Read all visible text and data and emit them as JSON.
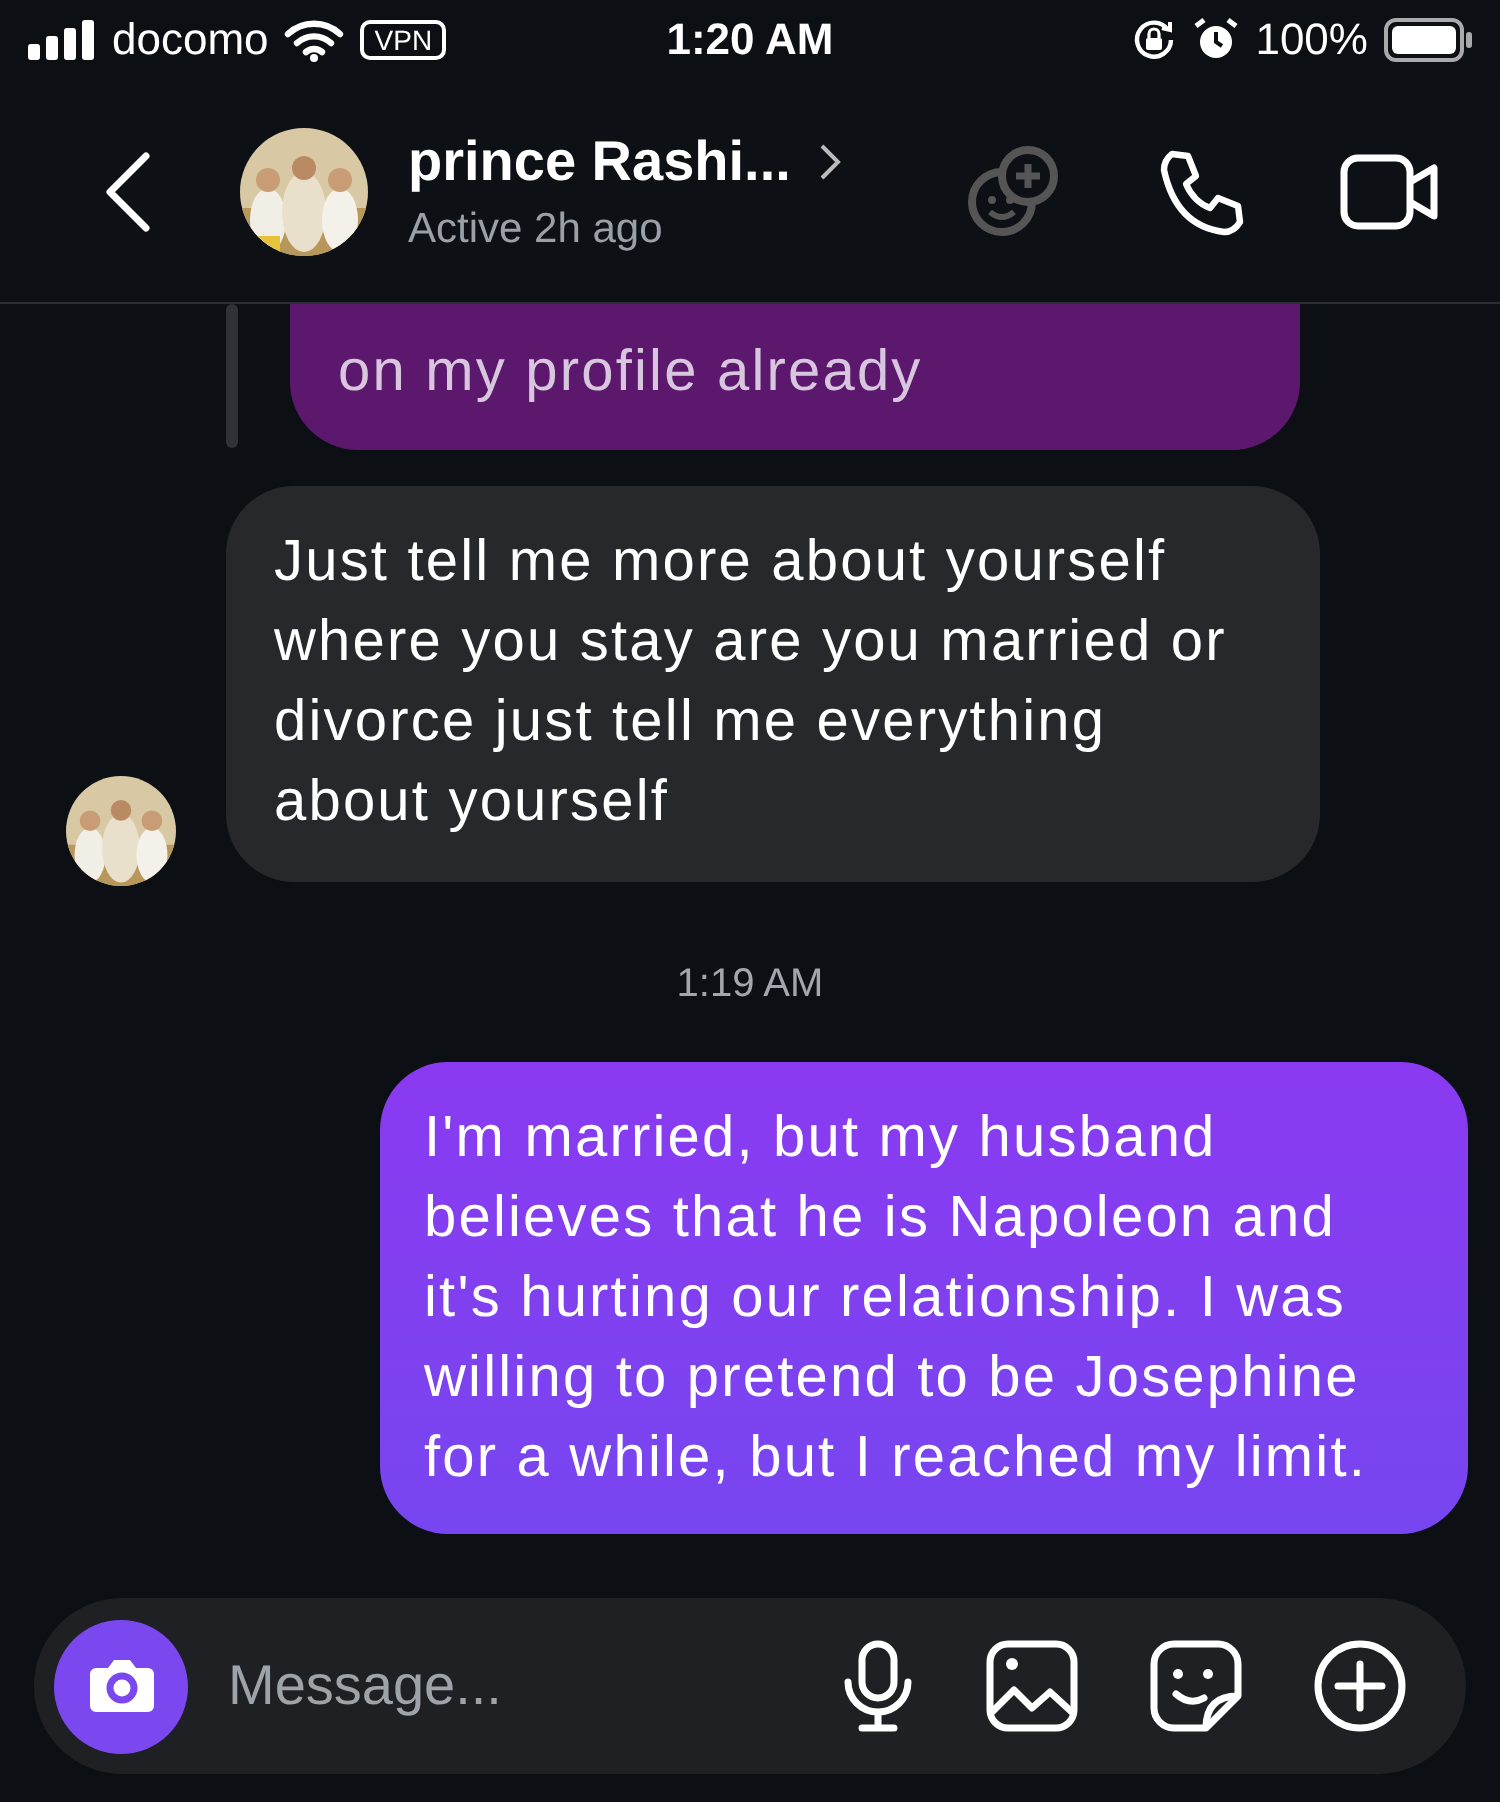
{
  "status_bar": {
    "carrier": "docomo",
    "vpn": "VPN",
    "time": "1:20 AM",
    "battery": "100%"
  },
  "header": {
    "name": "prince Rashi...",
    "status": "Active 2h ago"
  },
  "messages": [
    {
      "kind": "sent",
      "replied": true,
      "text": "on my profile already"
    },
    {
      "kind": "received",
      "text": "Just tell me more about yourself where you stay are you married or divorce just tell me everything about  yourself"
    },
    {
      "kind": "timestamp",
      "text": "1:19 AM"
    },
    {
      "kind": "sent",
      "replied": false,
      "text": "I'm married, but my husband believes that he is Napoleon and it's hurting our relationship. I was willing to pretend to be Josephine for a while, but I reached my limit."
    }
  ],
  "composer": {
    "placeholder": "Message..."
  }
}
